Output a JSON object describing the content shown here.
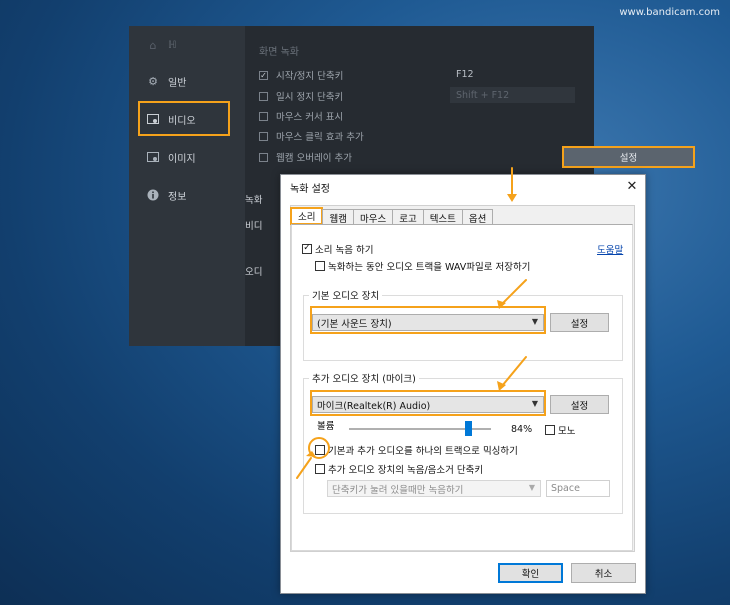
{
  "watermark": "www.bandicam.com",
  "bandicam": {
    "sidebar": {
      "home_label": "ℍ",
      "items": [
        {
          "label": "일반",
          "icon": "gear-icon"
        },
        {
          "label": "비디오",
          "icon": "video-settings-icon"
        },
        {
          "label": "이미지",
          "icon": "image-icon"
        },
        {
          "label": "정보",
          "icon": "info-icon"
        }
      ]
    },
    "section_title": "화면 녹화",
    "options": [
      {
        "label": "시작/정지 단축키",
        "checked": true
      },
      {
        "label": "일시 정지 단축키",
        "checked": false
      },
      {
        "label": "마우스 커서 표시",
        "checked": false
      },
      {
        "label": "마우스 클릭 효과 추가",
        "checked": false
      },
      {
        "label": "웹캠 오버레이 추가",
        "checked": false
      }
    ],
    "hotkey_start": "F12",
    "hotkey_pause": "Shift + F12",
    "settings_button": "설정",
    "lower_labels": [
      "녹화",
      "비디",
      "오디"
    ]
  },
  "dialog": {
    "title": "녹화 설정",
    "close": "✕",
    "tabs": [
      "소리",
      "웹캠",
      "마우스",
      "로고",
      "텍스트",
      "옵션"
    ],
    "active_tab": 0,
    "record_sound": {
      "label": "소리 녹음 하기",
      "checked": true
    },
    "save_wav": {
      "label": "녹화하는 동안 오디오 트랙을 WAV파일로 저장하기",
      "checked": false
    },
    "help": "도움말",
    "primary_group": {
      "label": "기본 오디오 장치",
      "device": "(기본 사운드 장치)",
      "button": "설정"
    },
    "secondary_group": {
      "label": "추가 오디오 장치 (마이크)",
      "device": "마이크(Realtek(R) Audio)",
      "button": "설정",
      "volume_label": "볼륨",
      "volume_value": "84%",
      "volume": 0.84,
      "mono_label": "모노",
      "mono_checked": false,
      "mix_label": "기본과 추가 오디오를 하나의 트랙으로 믹싱하기",
      "mix_checked": false,
      "hotkey_label": "추가 오디오 장치의 녹음/음소거 단축키",
      "hotkey_checked": false,
      "hotkey_mode": "단축키가 눌려 있을때만 녹음하기",
      "hotkey_key": "Space"
    },
    "ok": "확인",
    "cancel": "취소"
  },
  "colors": {
    "highlight": "#f5a21b",
    "link": "#0645ad",
    "accent": "#0078d7"
  }
}
